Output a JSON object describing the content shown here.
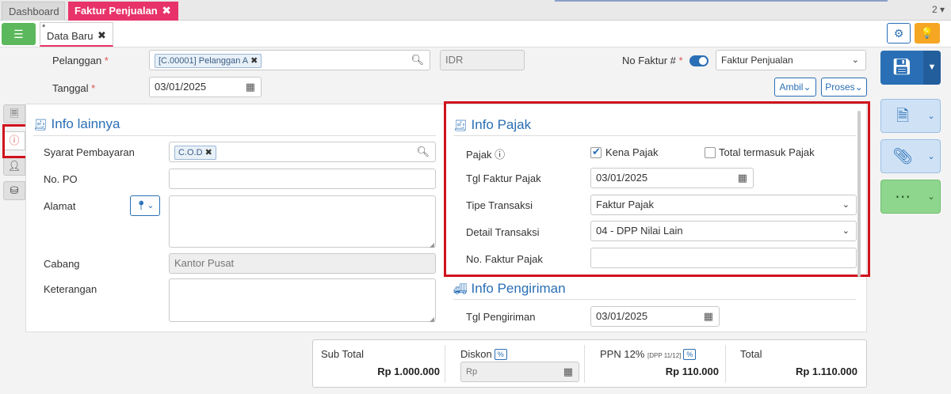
{
  "tabs": {
    "dashboard": "Dashboard",
    "faktur": "Faktur Penjualan",
    "count": "2"
  },
  "doc_tab": {
    "star": "*",
    "label": "Data Baru"
  },
  "header": {
    "pelanggan_label": "Pelanggan",
    "pelanggan_chip": "[C.00001] Pelanggan A",
    "currency": "IDR",
    "no_faktur_label": "No Faktur #",
    "no_faktur_select": "Faktur Penjualan",
    "tanggal_label": "Tanggal",
    "tanggal_value": "03/01/2025",
    "ambil_label": "Ambil",
    "proses_label": "Proses",
    "required_mark": "*"
  },
  "info_lainnya": {
    "title": "Info lainnya",
    "syarat_label": "Syarat Pembayaran",
    "syarat_chip": "C.O.D",
    "po_label": "No. PO",
    "alamat_label": "Alamat",
    "cabang_label": "Cabang",
    "cabang_value": "Kantor Pusat",
    "keterangan_label": "Keterangan"
  },
  "info_pajak": {
    "title": "Info Pajak",
    "pajak_label": "Pajak",
    "kena_pajak_label": "Kena Pajak",
    "kena_pajak_checked": true,
    "total_termasuk_label": "Total termasuk Pajak",
    "total_termasuk_checked": false,
    "tgl_faktur_label": "Tgl Faktur Pajak",
    "tgl_faktur_value": "03/01/2025",
    "tipe_label": "Tipe Transaksi",
    "tipe_value": "Faktur Pajak",
    "detail_label": "Detail Transaksi",
    "detail_value": "04 - DPP Nilai Lain",
    "no_faktur_pajak_label": "No. Faktur Pajak"
  },
  "info_pengiriman": {
    "title": "Info Pengiriman",
    "tgl_label": "Tgl Pengiriman",
    "tgl_value": "03/01/2025"
  },
  "totals": {
    "subtotal_label": "Sub Total",
    "subtotal_value": "Rp 1.000.000",
    "diskon_label": "Diskon",
    "diskon_badge": "%",
    "diskon_prefix": "Rp",
    "ppn_label": "PPN 12%",
    "ppn_sub": "[DPP 11/12]",
    "ppn_badge": "%",
    "ppn_value": "Rp 110.000",
    "total_label": "Total",
    "total_value": "Rp 1.110.000"
  },
  "colors": {
    "accent": "#e8336a",
    "primary": "#2a6fb5",
    "highlight": "#d0121d",
    "success": "#5cb85c"
  }
}
